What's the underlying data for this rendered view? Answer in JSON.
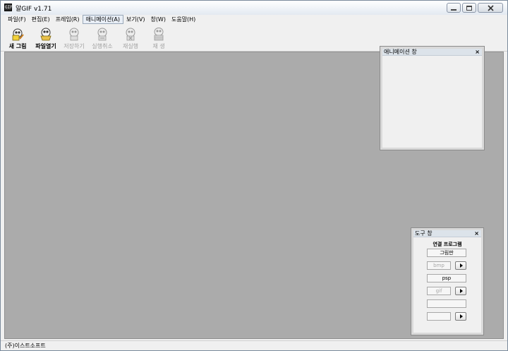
{
  "window": {
    "title": "알GIF v1.71",
    "icon_text": "GIF"
  },
  "menu": [
    {
      "label": "파일(F)"
    },
    {
      "label": "편집(E)"
    },
    {
      "label": "프레임(R)"
    },
    {
      "label": "애니메이션(A)"
    },
    {
      "label": "보기(V)"
    },
    {
      "label": "창(W)"
    },
    {
      "label": "도움말(H)"
    }
  ],
  "toolbar": [
    {
      "label": "새 그림",
      "icon": "new-image-icon",
      "enabled": true
    },
    {
      "label": "파일열기",
      "icon": "open-file-icon",
      "enabled": true
    },
    {
      "label": "저장하기",
      "icon": "save-icon",
      "enabled": false
    },
    {
      "label": "실행취소",
      "icon": "undo-icon",
      "enabled": false
    },
    {
      "label": "재실행",
      "icon": "redo-icon",
      "enabled": false
    },
    {
      "label": "재 생",
      "icon": "play-icon",
      "enabled": false
    }
  ],
  "animation_panel": {
    "title": "애니메이션 창",
    "close": "×"
  },
  "tools_panel": {
    "title": "도구 창",
    "close": "×",
    "group_label": "연결 프로그램",
    "fields": [
      {
        "label": "그림판",
        "enabled": true
      },
      {
        "label": "bmp",
        "enabled": false
      },
      {
        "label": "psp",
        "enabled": true
      },
      {
        "label": "gif",
        "enabled": false
      },
      {
        "label": "",
        "enabled": true
      },
      {
        "label": "",
        "enabled": false
      }
    ]
  },
  "statusbar": {
    "text": "(주)이스트소프트"
  },
  "colors": {
    "workspace": "#ababab",
    "chrome": "#f0f0f0",
    "panel_title": "#dce3ea"
  }
}
